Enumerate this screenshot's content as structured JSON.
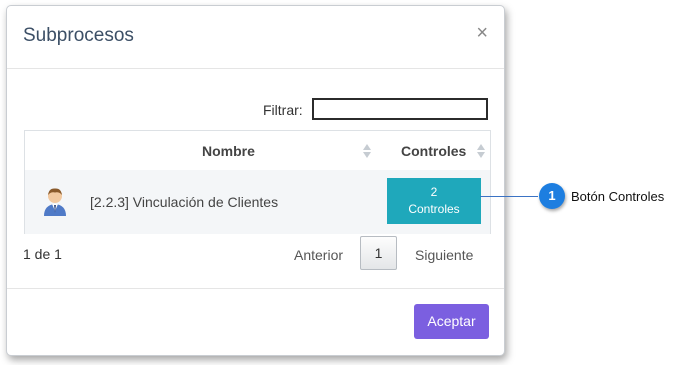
{
  "modal": {
    "title": "Subprocesos",
    "close_glyph": "×",
    "filter_label": "Filtrar:",
    "filter_value": ""
  },
  "table": {
    "columns": [
      "Nombre",
      "Controles"
    ],
    "rows": [
      {
        "icon": "user-avatar-icon",
        "name": "[2.2.3] Vinculación de Clientes",
        "controls_count": "2",
        "controls_label": "Controles"
      }
    ]
  },
  "pagination": {
    "info": "1 de 1",
    "prev": "Anterior",
    "current_page": "1",
    "next": "Siguiente"
  },
  "footer": {
    "accept": "Aceptar"
  },
  "callout": {
    "number": "1",
    "label": "Botón Controles"
  },
  "colors": {
    "controls_button": "#1fa8bb",
    "accept_button": "#7b5fe0",
    "callout": "#1d7ee0"
  }
}
